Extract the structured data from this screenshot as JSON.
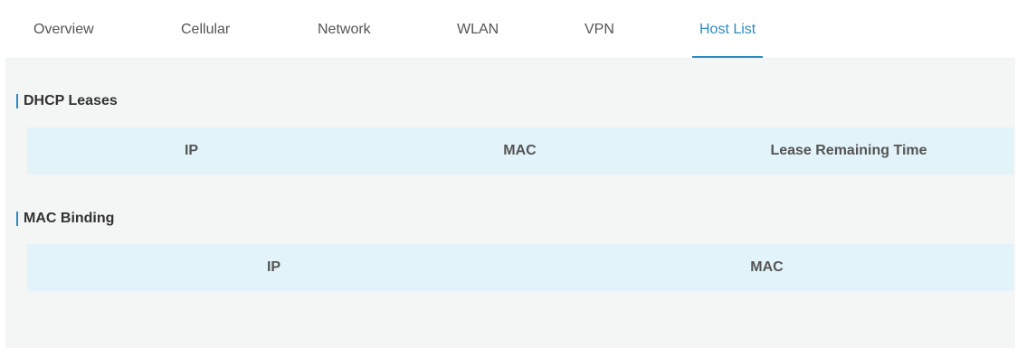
{
  "tabs": [
    {
      "label": "Overview"
    },
    {
      "label": "Cellular"
    },
    {
      "label": "Network"
    },
    {
      "label": "WLAN"
    },
    {
      "label": "VPN"
    },
    {
      "label": "Host List",
      "active": true
    }
  ],
  "dhcp_leases": {
    "title": "DHCP Leases",
    "columns": [
      "IP",
      "MAC",
      "Lease Remaining Time"
    ],
    "rows": []
  },
  "mac_binding": {
    "title": "MAC Binding",
    "columns": [
      "IP",
      "MAC"
    ],
    "rows": []
  },
  "colors": {
    "accent": "#2f8ac2",
    "table_header_bg": "#e2f3fa",
    "page_bg": "#f4f5f5"
  }
}
